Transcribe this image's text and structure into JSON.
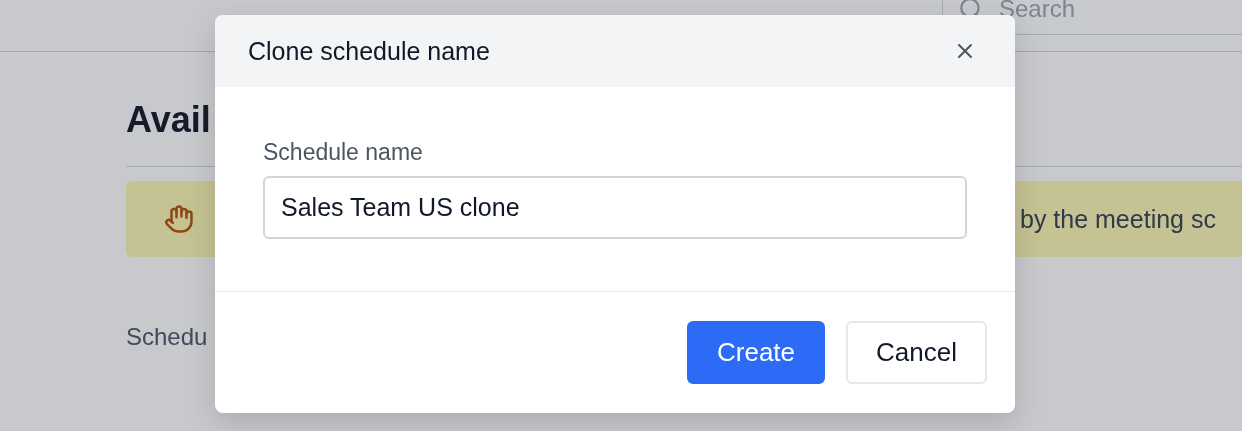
{
  "header": {
    "search": {
      "placeholder": "Search"
    }
  },
  "page": {
    "heading": "Avail",
    "notice": {
      "text": "by the meeting sc"
    },
    "label": "Schedu"
  },
  "dialog": {
    "title": "Clone schedule name",
    "field": {
      "label": "Schedule name",
      "value": "Sales Team US clone"
    },
    "buttons": [
      {
        "label": "Create",
        "kind": "primary"
      },
      {
        "label": "Cancel",
        "kind": "secondary"
      }
    ]
  }
}
